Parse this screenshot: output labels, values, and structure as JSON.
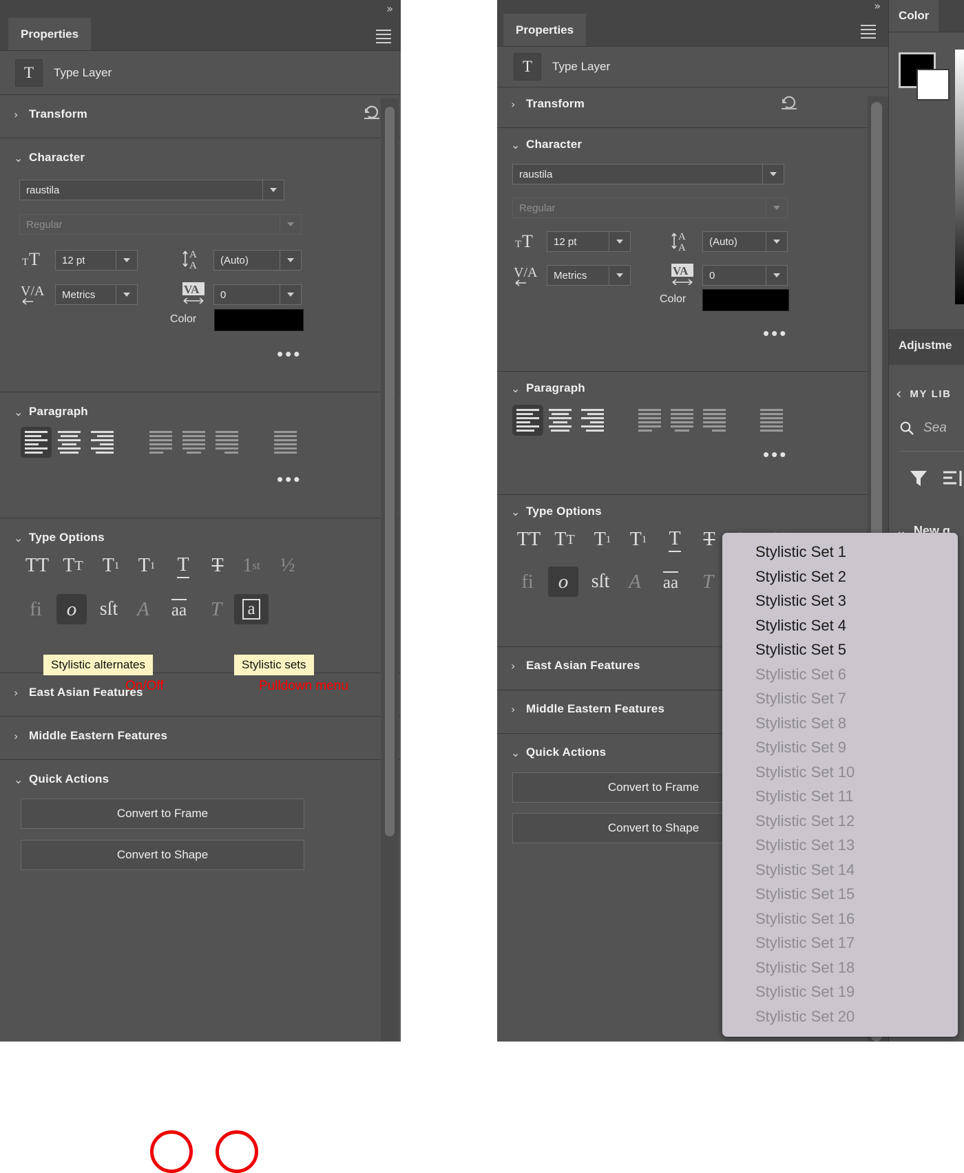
{
  "app": {
    "panel_title": "Properties",
    "collapse_icon": "chevron-double-right-icon",
    "menu_icon": "hamburger-menu-icon"
  },
  "layer": {
    "icon_glyph": "T",
    "name": "Type Layer"
  },
  "sections": {
    "transform": {
      "label": "Transform",
      "collapsed": true,
      "reset_icon": "reset-arrow-icon"
    },
    "character": {
      "label": "Character",
      "collapsed": false
    },
    "paragraph": {
      "label": "Paragraph",
      "collapsed": false
    },
    "type_options": {
      "label": "Type Options",
      "collapsed": false
    },
    "east_asian": {
      "label": "East Asian Features",
      "collapsed": true
    },
    "middle_eastern": {
      "label": "Middle Eastern Features",
      "collapsed": true
    },
    "quick_actions": {
      "label": "Quick Actions",
      "collapsed": false
    }
  },
  "character": {
    "font_family": "raustila",
    "font_style": "Regular",
    "font_style_disabled": true,
    "font_size": "12 pt",
    "leading": "(Auto)",
    "kerning": "Metrics",
    "tracking": "0",
    "color_label": "Color",
    "color_value": "#000000",
    "more_options": "•••"
  },
  "paragraph": {
    "align_buttons": [
      {
        "name": "align-left",
        "selected": true,
        "disabled": false
      },
      {
        "name": "align-center",
        "selected": false,
        "disabled": false
      },
      {
        "name": "align-right",
        "selected": false,
        "disabled": false
      },
      {
        "name": "justify-last-left",
        "selected": false,
        "disabled": true
      },
      {
        "name": "justify-last-center",
        "selected": false,
        "disabled": true
      },
      {
        "name": "justify-last-right",
        "selected": false,
        "disabled": true
      },
      {
        "name": "justify-all",
        "selected": false,
        "disabled": true
      }
    ],
    "more_options": "•••"
  },
  "type_options": {
    "row1": [
      {
        "name": "all-caps-icon",
        "glyph": "TT",
        "disabled": false,
        "selected": false
      },
      {
        "name": "small-caps-icon",
        "glyph": "TT",
        "disabled": false,
        "selected": false
      },
      {
        "name": "superscript-icon",
        "glyph": "T1",
        "disabled": false,
        "selected": false
      },
      {
        "name": "subscript-icon",
        "glyph": "T1",
        "disabled": false,
        "selected": false
      },
      {
        "name": "underline-icon",
        "glyph": "T",
        "disabled": false,
        "selected": false
      },
      {
        "name": "strikethrough-icon",
        "glyph": "T",
        "disabled": false,
        "selected": false
      },
      {
        "name": "ordinals-icon",
        "glyph": "1st",
        "disabled": true,
        "selected": false
      },
      {
        "name": "fractions-icon",
        "glyph": "1/2",
        "disabled": true,
        "selected": false
      }
    ],
    "row2": [
      {
        "name": "standard-ligatures-icon",
        "glyph": "fi",
        "disabled": true,
        "selected": false
      },
      {
        "name": "discretionary-ligatures-icon",
        "glyph": "o",
        "disabled": false,
        "selected": true
      },
      {
        "name": "contextual-alternates-icon",
        "glyph": "st",
        "disabled": false,
        "selected": false
      },
      {
        "name": "swash-icon",
        "glyph": "A",
        "disabled": true,
        "selected": false
      },
      {
        "name": "stylistic-alternates-icon",
        "glyph": "aa",
        "disabled": false,
        "selected": false
      },
      {
        "name": "titling-alternates-icon",
        "glyph": "T",
        "disabled": true,
        "selected": false
      },
      {
        "name": "stylistic-sets-icon",
        "glyph": "a",
        "disabled": false,
        "selected": true
      }
    ]
  },
  "quick_actions": {
    "buttons": [
      {
        "label": "Convert to Frame",
        "name": "convert-to-frame-button"
      },
      {
        "label": "Convert to Shape",
        "name": "convert-to-shape-button"
      }
    ]
  },
  "annotations": [
    {
      "id": "a1",
      "tooltip": "Stylistic alternates",
      "caption": "On/Off",
      "target": "stylistic-alternates-icon"
    },
    {
      "id": "a2",
      "tooltip": "Stylistic sets",
      "caption": "Pulldown menu",
      "target": "stylistic-sets-icon"
    }
  ],
  "annotation_color": "#ff0000",
  "tooltip_bg": "#fbf4c2",
  "color_panel": {
    "tab_label": "Color",
    "foreground": "#000000",
    "background": "#ffffff",
    "adjustments_label": "Adjustme",
    "library_back": "MY LIB",
    "library_search_placeholder": "Sea",
    "filter_icon": "funnel-icon",
    "sort_icon": "sort-list-icon",
    "group_label": "New g"
  },
  "stylistic_sets_menu": {
    "items": [
      {
        "label": "Stylistic Set 1",
        "enabled": true
      },
      {
        "label": "Stylistic Set 2",
        "enabled": true
      },
      {
        "label": "Stylistic Set 3",
        "enabled": true
      },
      {
        "label": "Stylistic Set 4",
        "enabled": true
      },
      {
        "label": "Stylistic Set 5",
        "enabled": true
      },
      {
        "label": "Stylistic Set 6",
        "enabled": false
      },
      {
        "label": "Stylistic Set 7",
        "enabled": false
      },
      {
        "label": "Stylistic Set 8",
        "enabled": false
      },
      {
        "label": "Stylistic Set 9",
        "enabled": false
      },
      {
        "label": "Stylistic Set 10",
        "enabled": false
      },
      {
        "label": "Stylistic Set 11",
        "enabled": false
      },
      {
        "label": "Stylistic Set 12",
        "enabled": false
      },
      {
        "label": "Stylistic Set 13",
        "enabled": false
      },
      {
        "label": "Stylistic Set 14",
        "enabled": false
      },
      {
        "label": "Stylistic Set 15",
        "enabled": false
      },
      {
        "label": "Stylistic Set 16",
        "enabled": false
      },
      {
        "label": "Stylistic Set 17",
        "enabled": false
      },
      {
        "label": "Stylistic Set 18",
        "enabled": false
      },
      {
        "label": "Stylistic Set 19",
        "enabled": false
      },
      {
        "label": "Stylistic Set 20",
        "enabled": false
      }
    ]
  }
}
